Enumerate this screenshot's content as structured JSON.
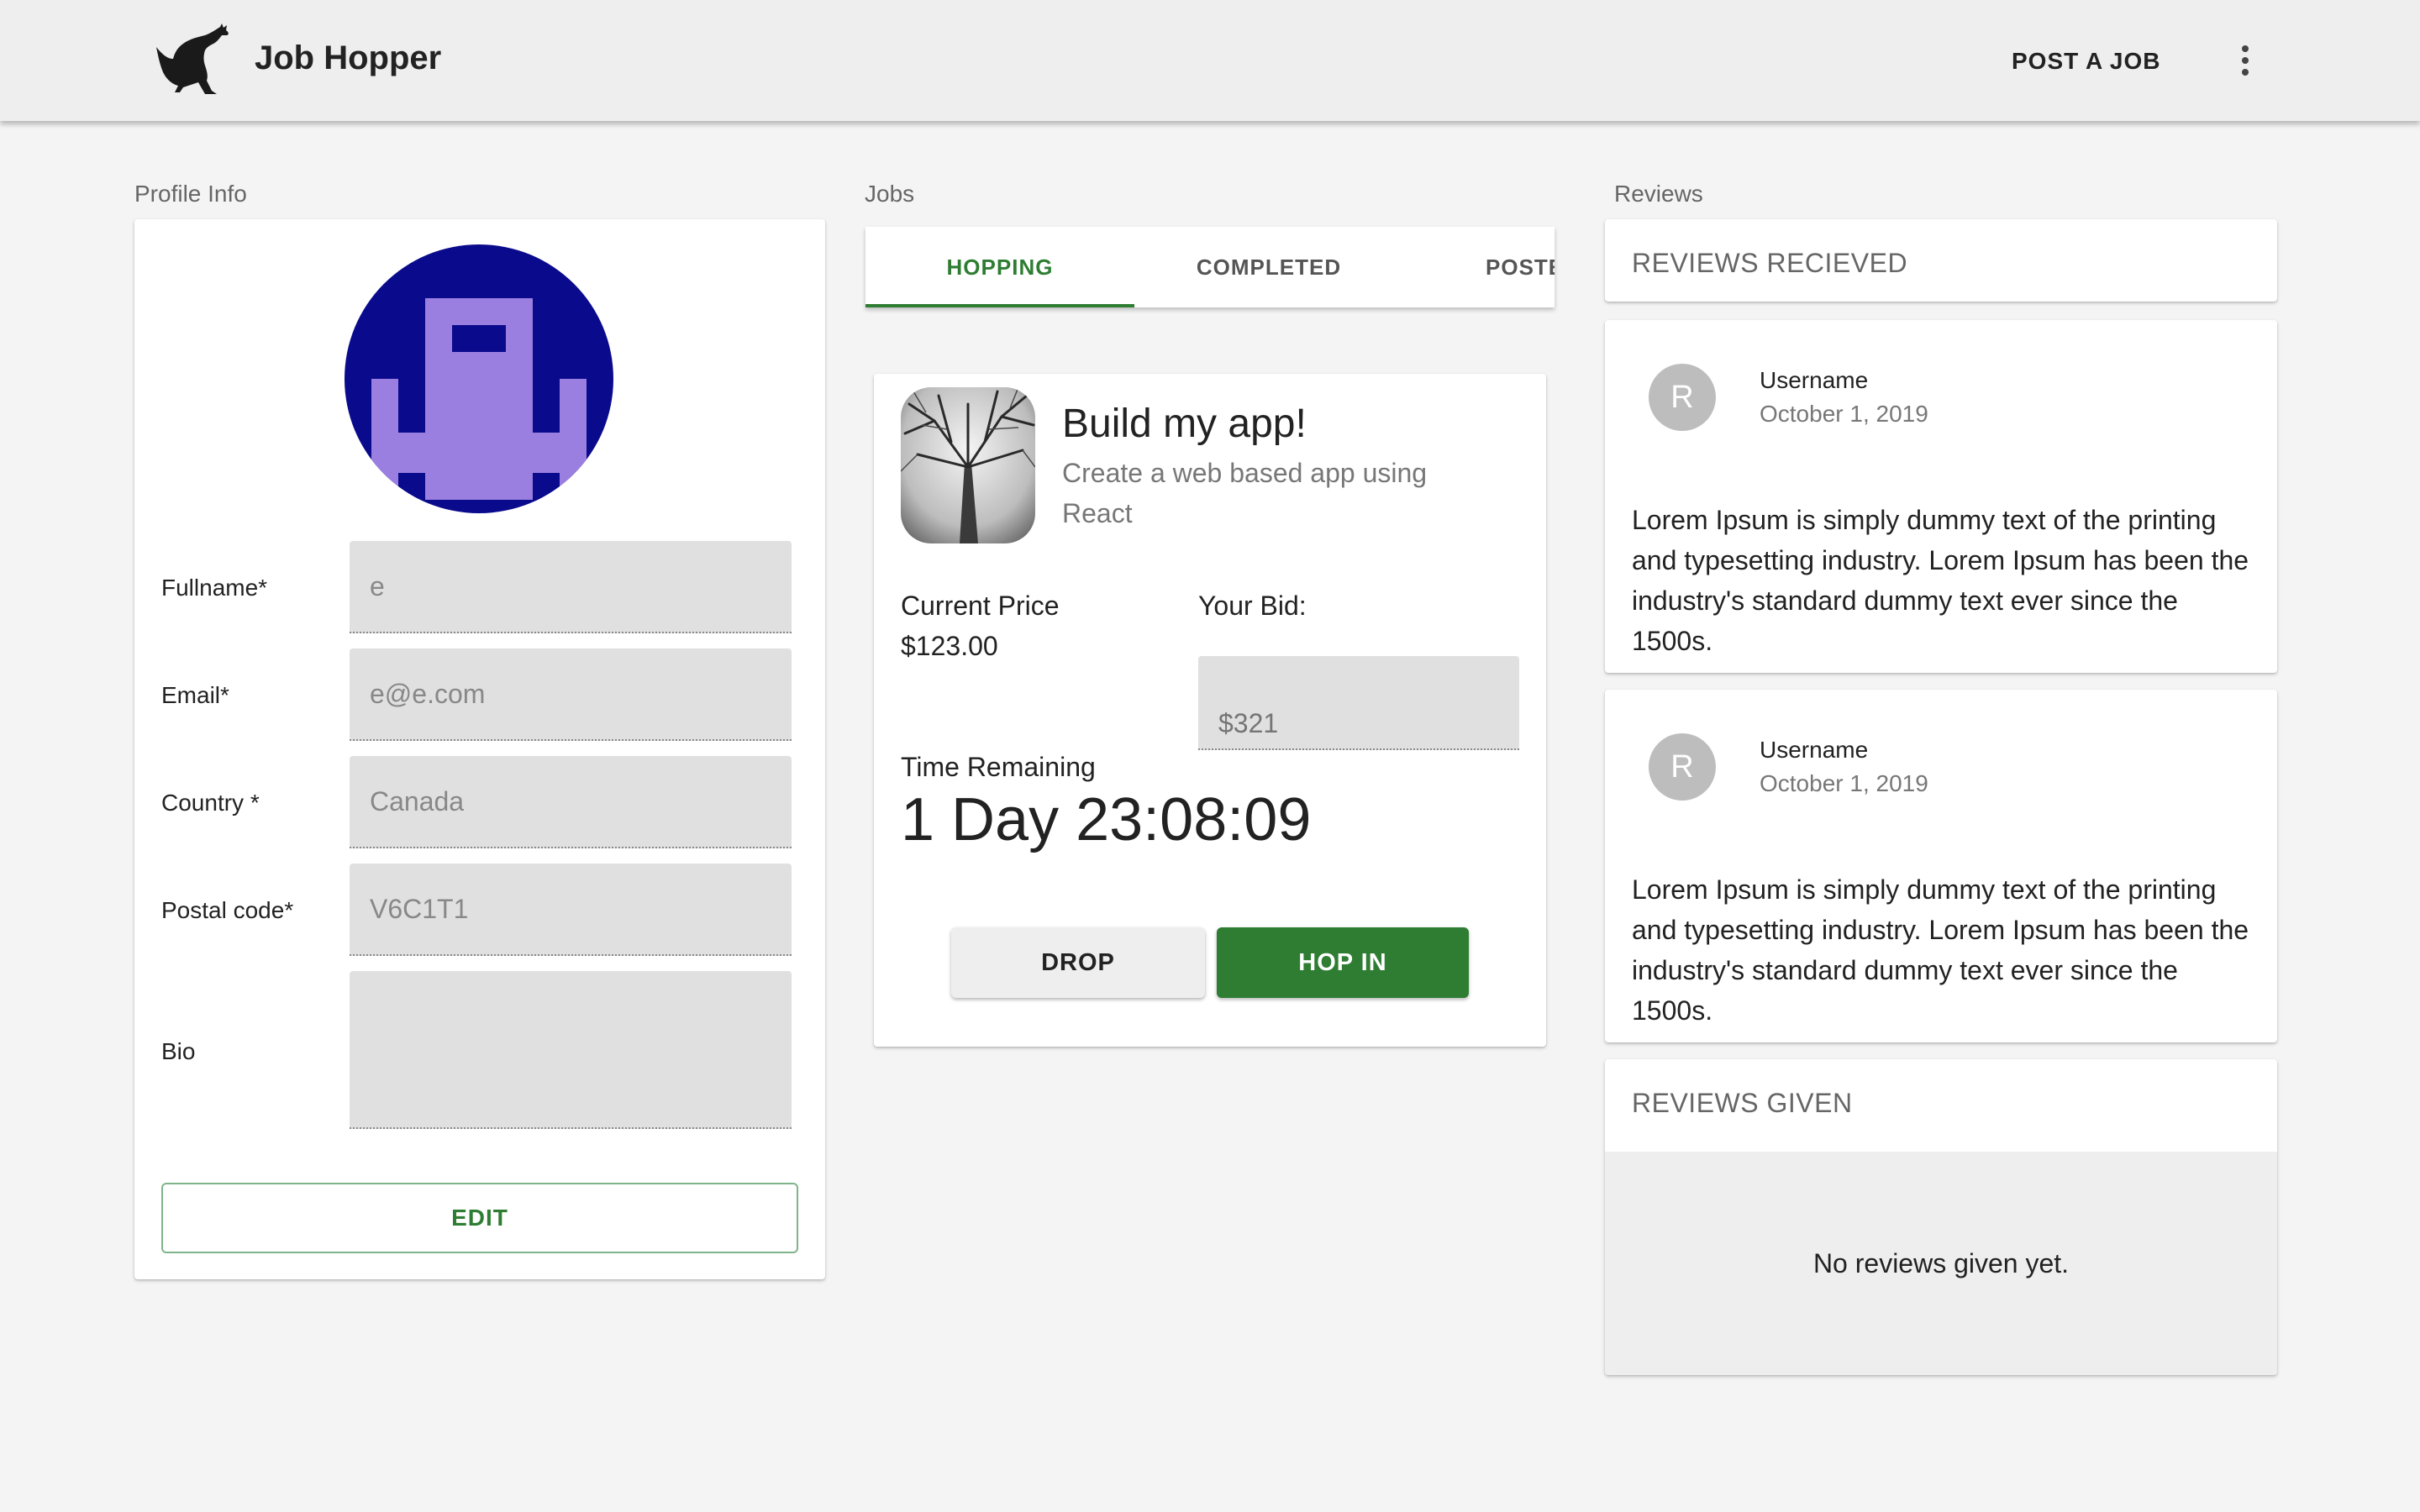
{
  "app": {
    "title": "Job Hopper",
    "post_job_label": "POST A JOB",
    "logo_icon": "kangaroo-logo",
    "more_icon": "more-vertical-icon"
  },
  "colors": {
    "accent": "#2e7d32",
    "appbar": "#eeeeee",
    "background": "#f4f4f4",
    "avatar_bg": "#0a0a8c",
    "avatar_fg": "#9b7fe0"
  },
  "profile": {
    "section_label": "Profile Info",
    "avatar_icon": "identicon-avatar",
    "fields": [
      {
        "label": "Fullname*",
        "value": "e"
      },
      {
        "label": "Email*",
        "value": "e@e.com"
      },
      {
        "label": "Country *",
        "value": "Canada"
      },
      {
        "label": "Postal code*",
        "value": "V6C1T1"
      },
      {
        "label": "Bio",
        "value": ""
      }
    ],
    "edit_label": "EDIT"
  },
  "jobs": {
    "section_label": "Jobs",
    "tabs": [
      {
        "label": "HOPPING",
        "active": true
      },
      {
        "label": "COMPLETED",
        "active": false
      },
      {
        "label": "POSTED",
        "active": false
      }
    ],
    "card": {
      "thumbnail_icon": "tree-photo",
      "title": "Build my app!",
      "description": "Create a web based app using React",
      "current_price_label": "Current Price",
      "current_price": "$123.00",
      "your_bid_label": "Your Bid:",
      "your_bid_placeholder": "$321",
      "time_remaining_label": "Time Remaining",
      "time_remaining": "1 Day 23:08:09",
      "drop_label": "DROP",
      "hop_in_label": "HOP IN"
    }
  },
  "reviews": {
    "section_label": "Reviews",
    "received_header": "REVIEWS RECIEVED",
    "received": [
      {
        "avatar_letter": "R",
        "username": "Username",
        "date": "October 1, 2019",
        "text": "Lorem Ipsum is simply dummy text of the printing and typesetting industry. Lorem Ipsum has been the industry's standard dummy text ever since the 1500s."
      },
      {
        "avatar_letter": "R",
        "username": "Username",
        "date": "October 1, 2019",
        "text": "Lorem Ipsum is simply dummy text of the printing and typesetting industry. Lorem Ipsum has been the industry's standard dummy text ever since the 1500s."
      }
    ],
    "given_header": "REVIEWS GIVEN",
    "given_empty": "No reviews given yet."
  }
}
